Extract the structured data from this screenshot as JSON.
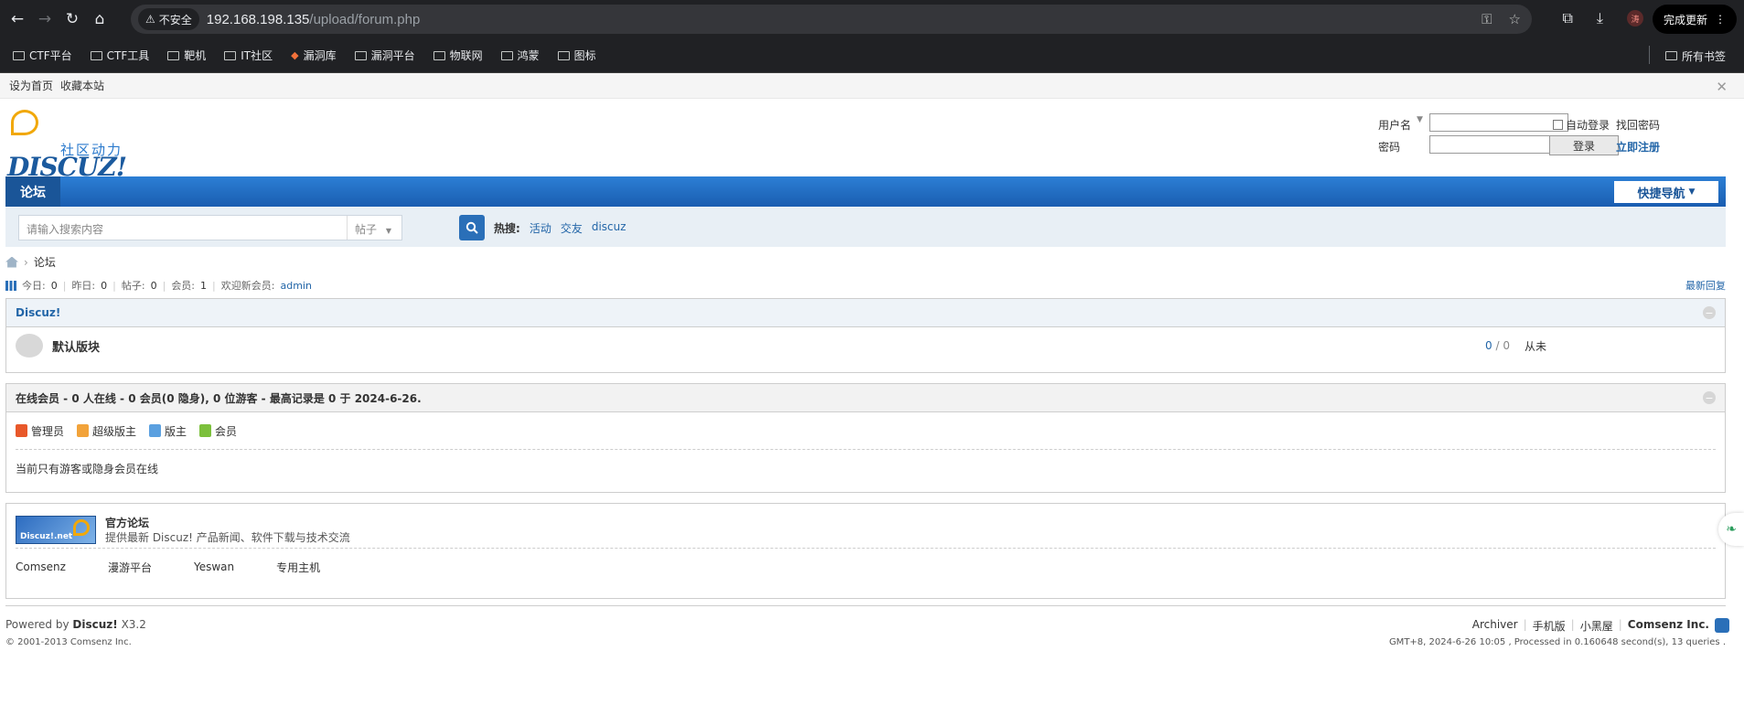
{
  "browser": {
    "insecure_label": "不安全",
    "url_host": "192.168.198.135",
    "url_path": "/upload/forum.php",
    "update_label": "完成更新",
    "avatar_letter": "涛"
  },
  "bookmarks": {
    "items": [
      "CTF平台",
      "CTF工具",
      "靶机",
      "IT社区",
      "漏洞库",
      "漏洞平台",
      "物联网",
      "鸿蒙",
      "图标"
    ],
    "all_label": "所有书签"
  },
  "topbar": {
    "set_home": "设为首页",
    "bookmark_site": "收藏本站"
  },
  "logo": {
    "sub": "社区动力",
    "main": "DISCUZ!"
  },
  "login": {
    "username_label": "用户名",
    "password_label": "密码",
    "auto_login": "自动登录",
    "find_password": "找回密码",
    "login_button": "登录",
    "register": "立即注册"
  },
  "nav": {
    "forum": "论坛",
    "quick_nav": "快捷导航"
  },
  "search": {
    "placeholder": "请输入搜索内容",
    "type": "帖子",
    "hot_label": "热搜:",
    "hot_items": [
      "活动",
      "交友",
      "discuz"
    ]
  },
  "breadcrumb": {
    "current": "论坛"
  },
  "stats": {
    "today_label": "今日:",
    "today": "0",
    "yesterday_label": "昨日:",
    "yesterday": "0",
    "posts_label": "帖子:",
    "posts": "0",
    "members_label": "会员:",
    "members": "1",
    "welcome_label": "欢迎新会员:",
    "newest": "admin",
    "latest_reply": "最新回复"
  },
  "category": {
    "title": "Discuz!",
    "forum_name": "默认版块",
    "threads": "0",
    "posts": "0",
    "last_post": "从未"
  },
  "online": {
    "title": "在线会员 - 0 人在线 - 0 会员(0 隐身), 0 位游客 - 最高记录是 0 于 2024-6-26.",
    "legend": [
      {
        "label": "管理员",
        "color": "#e8582a"
      },
      {
        "label": "超级版主",
        "color": "#f2a33a"
      },
      {
        "label": "版主",
        "color": "#5aa0e0"
      },
      {
        "label": "会员",
        "color": "#7cc03c"
      }
    ],
    "note": "当前只有游客或隐身会员在线"
  },
  "links": {
    "banner_text": "Discuz!.net",
    "title": "官方论坛",
    "desc": "提供最新 Discuz! 产品新闻、软件下载与技术交流",
    "items": [
      "Comsenz",
      "漫游平台",
      "Yeswan",
      "专用主机"
    ]
  },
  "footer": {
    "powered": "Powered by",
    "product": "Discuz!",
    "version": "X3.2",
    "copyright": "© 2001-2013 Comsenz Inc.",
    "links": [
      "Archiver",
      "手机版",
      "小黑屋"
    ],
    "company": "Comsenz Inc.",
    "gmt": "GMT+8, 2024-6-26 10:05 , Processed in 0.160648 second(s), 13 queries ."
  }
}
